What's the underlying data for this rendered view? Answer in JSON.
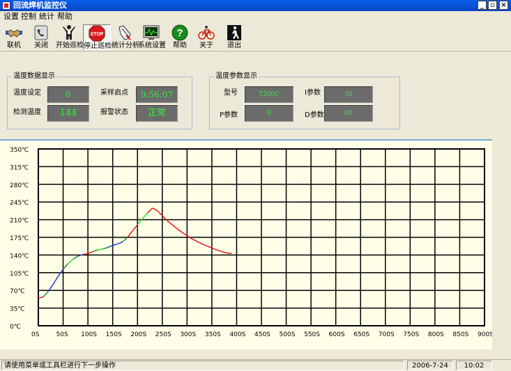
{
  "window": {
    "title": "回流焊机监控仪"
  },
  "menu": [
    "设置",
    "控制",
    "统计",
    "帮助"
  ],
  "toolbar": [
    {
      "label": "联机",
      "icon": "handshake-icon"
    },
    {
      "label": "关闭",
      "icon": "phone-icon"
    },
    {
      "label": "开始巡检",
      "icon": "person-arms-up-icon"
    },
    {
      "label": "停止巡检",
      "icon": "stop-sign-icon",
      "icon_text": "STOP"
    },
    {
      "label": "统计分析",
      "icon": "hand-pen-icon"
    },
    {
      "label": "系统设置",
      "icon": "monitor-wave-icon"
    },
    {
      "label": "帮助",
      "icon": "help-icon",
      "icon_text": "?"
    },
    {
      "label": "关于",
      "icon": "bicycle-icon"
    },
    {
      "label": "退出",
      "icon": "exit-person-icon"
    }
  ],
  "temp_panel": {
    "title": "温度数据显示",
    "setpoint_label": "温度设定",
    "setpoint_value": "0",
    "sample_start_label": "采样启点",
    "sample_start_value": "9:56:07",
    "measured_label": "检测温度",
    "measured_value": "144",
    "alarm_label": "报警状态",
    "alarm_value": "正常"
  },
  "param_panel": {
    "title": "温度参数显示",
    "model_label": "型号",
    "model_value": "T200C",
    "i_label": "I参数",
    "i_value": "30",
    "p_label": "P参数",
    "p_value": "0",
    "d_label": "D参数",
    "d_value": "60"
  },
  "colors": {
    "grid": "#000000",
    "background": "#ffffe8",
    "lcd_text": "#2cf23c",
    "lcd_bg": "#6b6b6b",
    "rising": "#1f3bd6",
    "falling": "#e01b1b"
  },
  "chart_data": {
    "type": "line",
    "xlim": [
      0,
      900
    ],
    "ylim": [
      0,
      350
    ],
    "x_ticks": [
      "0S",
      "50S",
      "100S",
      "150S",
      "200S",
      "250S",
      "300S",
      "350S",
      "400S",
      "450S",
      "500S",
      "550S",
      "600S",
      "650S",
      "700S",
      "750S",
      "800S",
      "850S",
      "900S"
    ],
    "y_ticks": [
      "0℃",
      "35℃",
      "70℃",
      "105℃",
      "140℃",
      "175℃",
      "210℃",
      "245℃",
      "280℃",
      "315℃",
      "350℃"
    ],
    "grid": true,
    "series": [
      {
        "color_note": "multicolor segments",
        "x": [
          0,
          10,
          20,
          30,
          40,
          50,
          60,
          70,
          80,
          90,
          100,
          110,
          120,
          130,
          140,
          150,
          160,
          170,
          180,
          190,
          200,
          210,
          220,
          230,
          240,
          250,
          260,
          270,
          280,
          290,
          300,
          310,
          320,
          330,
          340,
          350,
          360,
          370,
          380,
          390
        ],
        "y": [
          55,
          57,
          68,
          82,
          98,
          112,
          123,
          132,
          138,
          141,
          143,
          147,
          150,
          152,
          155,
          159,
          162,
          166,
          175,
          188,
          200,
          212,
          223,
          233,
          228,
          218,
          208,
          200,
          192,
          185,
          178,
          172,
          167,
          162,
          158,
          154,
          150,
          147,
          144,
          143
        ],
        "segment_colors": [
          "#e01b1b",
          "#2a8a2a",
          "#1f3bd6",
          "#1f3bd6",
          "#1f3bd6",
          "#2a8a2a",
          "#33dd33",
          "#2a8a2a",
          "#1f3bd6",
          "#e01b1b",
          "#e01b1b",
          "#2a8a2a",
          "#33dd33",
          "#2a8a2a",
          "#1f3bd6",
          "#1f3bd6",
          "#1f3bd6",
          "#2a8a2a",
          "#e01b1b",
          "#e01b1b",
          "#33dd33",
          "#33dd33",
          "#e01b1b",
          "#e01b1b",
          "#e01b1b",
          "#e01b1b",
          "#e01b1b",
          "#e01b1b",
          "#e01b1b",
          "#e01b1b",
          "#e01b1b",
          "#e01b1b",
          "#e01b1b",
          "#e01b1b",
          "#e01b1b",
          "#e01b1b",
          "#e01b1b",
          "#e01b1b",
          "#e01b1b"
        ]
      }
    ]
  },
  "status": {
    "message": "请使用菜单或工具栏进行下一步操作",
    "date": "2006-7-24",
    "time": "10:02"
  }
}
